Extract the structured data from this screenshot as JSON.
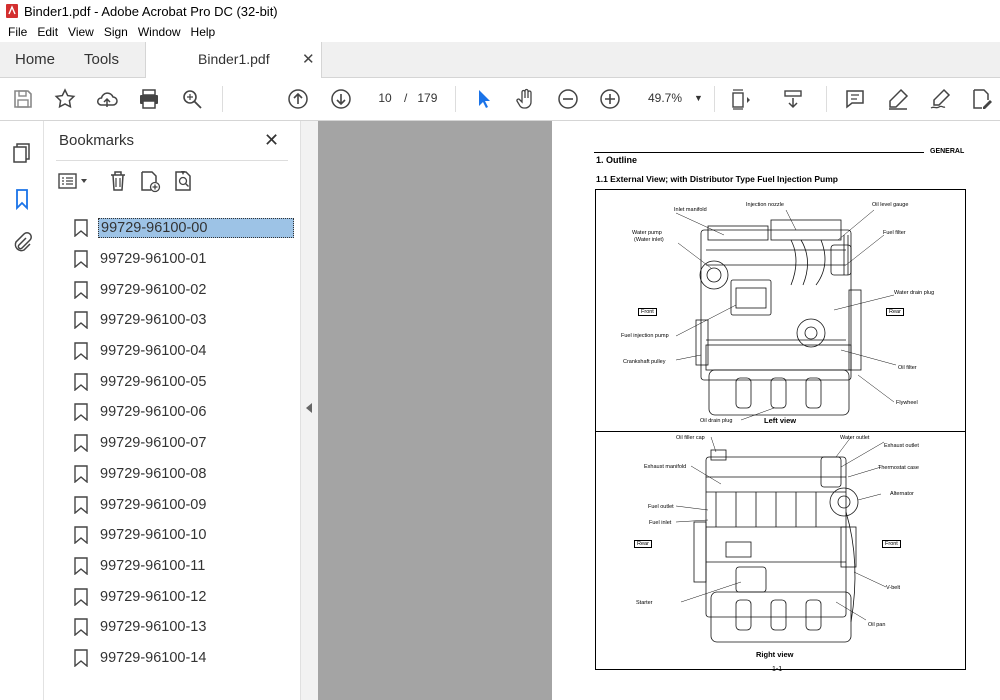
{
  "window": {
    "title": "Binder1.pdf - Adobe Acrobat Pro DC (32-bit)"
  },
  "menu": [
    "File",
    "Edit",
    "View",
    "Sign",
    "Window",
    "Help"
  ],
  "tabs": {
    "home": "Home",
    "tools": "Tools",
    "document": "Binder1.pdf",
    "close": "✕"
  },
  "toolbar": {
    "page_current": "10",
    "page_sep": "/",
    "page_total": "179",
    "zoom": "49.7%"
  },
  "bookmarks": {
    "title": "Bookmarks",
    "close": "✕",
    "selected_index": 0,
    "items": [
      "99729-96100-00",
      "99729-96100-01",
      "99729-96100-02",
      "99729-96100-03",
      "99729-96100-04",
      "99729-96100-05",
      "99729-96100-06",
      "99729-96100-07",
      "99729-96100-08",
      "99729-96100-09",
      "99729-96100-10",
      "99729-96100-11",
      "99729-96100-12",
      "99729-96100-13",
      "99729-96100-14"
    ]
  },
  "document": {
    "header_right": "GENERAL",
    "section": "1.   Outline",
    "subsection": "1.1   External View; with Distributor Type Fuel Injection Pump",
    "left_view": {
      "caption": "Left view",
      "front": "Front",
      "rear": "Rear",
      "labels": [
        "Inlet manifold",
        "Injection nozzle",
        "Oil level gauge",
        "Water pump",
        "(Water inlet)",
        "Fuel filter",
        "Water drain plug",
        "Fuel injection pump",
        "Crankshaft pulley",
        "Oil filter",
        "Flywheel",
        "Oil drain plug"
      ]
    },
    "right_view": {
      "caption": "Right view",
      "front": "Front",
      "rear": "Rear",
      "labels": [
        "Oil filler cap",
        "Water outlet",
        "Exhaust outlet",
        "Thermostat case",
        "Exhaust manifold",
        "Alternator",
        "Fuel outlet",
        "Fuel inlet",
        "Starter",
        "V-belt",
        "Oil pan"
      ]
    },
    "page_number": "1-1"
  }
}
